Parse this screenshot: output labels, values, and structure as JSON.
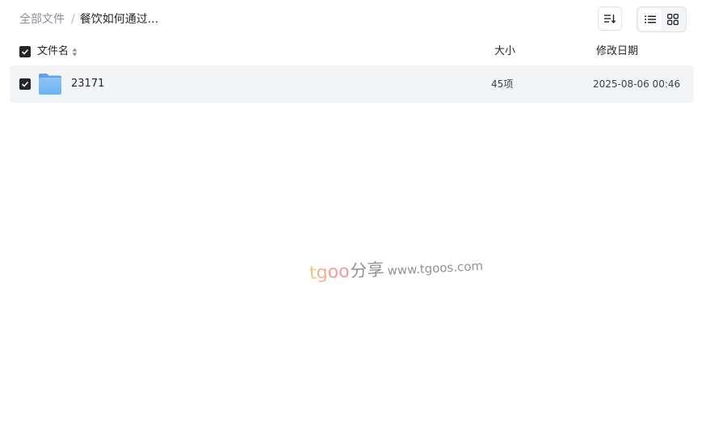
{
  "breadcrumb": {
    "root": "全部文件",
    "separator": "/",
    "current": "餐饮如何通过..."
  },
  "toolbar": {
    "sort_icon": "sort-descending-icon",
    "list_view_icon": "list-view-icon",
    "grid_view_icon": "grid-view-icon",
    "active_view": "list"
  },
  "table": {
    "select_all_checked": true,
    "columns": {
      "name": "文件名",
      "size": "大小",
      "modified": "修改日期"
    },
    "rows": [
      {
        "checked": true,
        "icon": "folder-icon",
        "name": "23171",
        "size": "45项",
        "modified": "2025-08-06 00:46"
      }
    ]
  },
  "watermark": {
    "brand_chars": [
      "t",
      "g",
      "o",
      "o"
    ],
    "chinese": "分享",
    "url": "www.tgoos.com"
  },
  "colors": {
    "checkbox": "#25262b",
    "row_bg": "#f3f4f6",
    "folder": "#7ab8f5",
    "text_primary": "#25262b",
    "text_muted": "#8a8e99"
  }
}
